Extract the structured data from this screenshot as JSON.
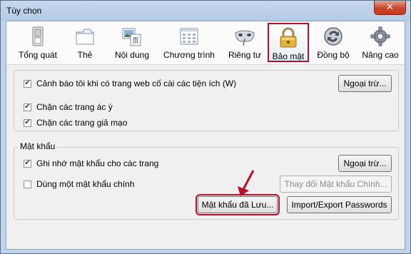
{
  "window": {
    "title": "Tùy chọn",
    "close_label": "✕"
  },
  "toolbar": {
    "items": [
      {
        "label": "Tổng quát",
        "icon": "switch-icon"
      },
      {
        "label": "Thẻ",
        "icon": "tabs-icon"
      },
      {
        "label": "Nội dung",
        "icon": "content-icon"
      },
      {
        "label": "Chương trình",
        "icon": "applications-icon"
      },
      {
        "label": "Riêng tư",
        "icon": "mask-icon"
      },
      {
        "label": "Bảo mật",
        "icon": "padlock-icon",
        "selected": true
      },
      {
        "label": "Đồng bộ",
        "icon": "sync-icon"
      },
      {
        "label": "Nâng cao",
        "icon": "gear-icon"
      }
    ]
  },
  "security": {
    "warn_addons_label": "Cảnh báo tôi khi có trang web cố cài các tiện ích (W)",
    "exceptions_label": "Ngoại trừ...",
    "block_attack_label": "Chặn các trang ác ý",
    "block_forgery_label": "Chặn các trang giả mạo"
  },
  "passwords": {
    "group_label": "Mật khẩu",
    "remember_label": "Ghi nhớ mật khẩu cho các trang",
    "exceptions_label": "Ngoại trừ...",
    "master_password_label": "Dùng một mật khẩu chính",
    "change_master_label": "Thay đổi Mật khẩu Chính...",
    "saved_passwords_label": "Mật khẩu đã Lưu...",
    "import_export_label": "Import/Export Passwords"
  },
  "colors": {
    "highlight": "#b8102a",
    "checkmark": "#1f3a6b"
  }
}
